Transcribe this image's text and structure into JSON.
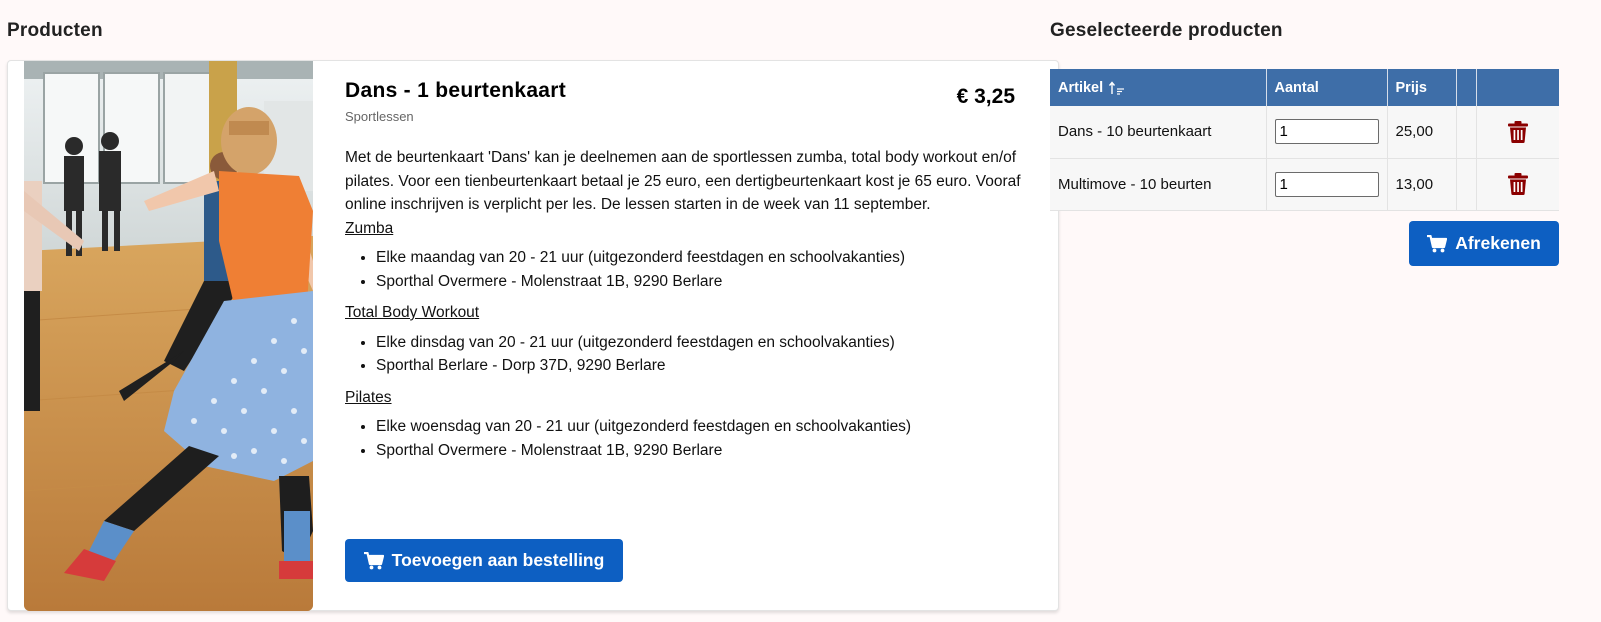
{
  "products_section": {
    "title": "Producten",
    "product": {
      "name": "Dans - 1 beurtenkaart",
      "category": "Sportlessen",
      "price": "€ 3,25",
      "intro": "Met de beurtenkaart 'Dans' kan je deelnemen aan de sportlessen zumba, total body workout en/of pilates. Voor een tienbeurtenkaart betaal je 25 euro, een dertigbeurtenkaart kost je 65 euro. Vooraf online inschrijven is verplicht per les. De lessen starten in de week van 11 september.",
      "lessons": [
        {
          "name": "Zumba",
          "items": [
            "Elke maandag van 20 - 21 uur (uitgezonderd feestdagen en schoolvakanties)",
            "Sporthal Overmere - Molenstraat 1B, 9290 Berlare"
          ]
        },
        {
          "name": "Total Body Workout",
          "items": [
            "Elke dinsdag van 20 - 21 uur (uitgezonderd feestdagen en schoolvakanties)",
            "Sporthal Berlare - Dorp 37D, 9290 Berlare"
          ]
        },
        {
          "name": "Pilates",
          "items": [
            "Elke woensdag van 20 - 21 uur (uitgezonderd feestdagen en schoolvakanties)",
            "Sporthal Overmere - Molenstraat 1B, 9290 Berlare"
          ]
        }
      ],
      "add_button_label": "Toevoegen aan bestelling",
      "add_button_icon": "cart-icon",
      "image_icon": "dance-class-photo"
    }
  },
  "cart": {
    "title": "Geselecteerde producten",
    "columns": [
      "Artikel",
      "Aantal",
      "Prijs",
      "",
      ""
    ],
    "sort_icon": "sort-ascending-icon",
    "rows": [
      {
        "article": "Dans - 10 beurtenkaart",
        "quantity": "1",
        "price": "25,00"
      },
      {
        "article": "Multimove - 10 beurten",
        "quantity": "1",
        "price": "13,00"
      }
    ],
    "delete_icon": "trash-icon",
    "checkout_label": "Afrekenen",
    "checkout_icon": "cart-icon"
  },
  "colors": {
    "page_background": "#fff9f9",
    "primary_button": "#0d5fc2",
    "table_header": "#3e6ea8",
    "delete_icon": "#8b0000"
  }
}
